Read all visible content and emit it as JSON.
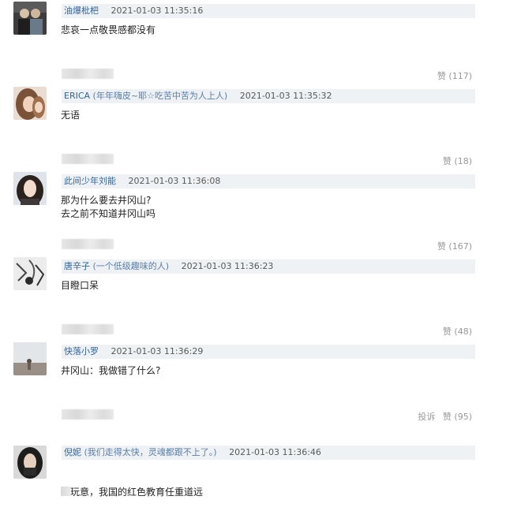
{
  "comments": [
    {
      "username": "油爆枇杷",
      "note": "",
      "time": "2021-01-03 11:35:16",
      "text": "悲哀一点敬畏感都没有",
      "like_label": "赞 (117)",
      "report_label": ""
    },
    {
      "username": "ERICA",
      "note": "(年年嗨皮~耶☆吃苦中苦为人上人)",
      "time": "2021-01-03 11:35:32",
      "text": "无语",
      "like_label": "赞 (18)",
      "report_label": ""
    },
    {
      "username": "此间少年刘能",
      "note": "",
      "time": "2021-01-03 11:36:08",
      "text": "那为什么要去井冈山?\n去之前不知道井冈山吗",
      "like_label": "赞 (167)",
      "report_label": ""
    },
    {
      "username": "唐辛子",
      "note": "(一个低级趣味的人)",
      "time": "2021-01-03 11:36:23",
      "text": "目瞪口呆",
      "like_label": "赞 (48)",
      "report_label": ""
    },
    {
      "username": "快落小罗",
      "note": "",
      "time": "2021-01-03 11:36:29",
      "text": "井冈山：我做错了什么?",
      "like_label": "赞 (95)",
      "report_label": "投诉"
    },
    {
      "username": "倪妮",
      "note": "(我们走得太快，灵魂都跟不上了。)",
      "time": "2021-01-03 11:36:46",
      "text": "玩意，我国的红色教育任重道远",
      "like_label": "",
      "report_label": ""
    }
  ]
}
